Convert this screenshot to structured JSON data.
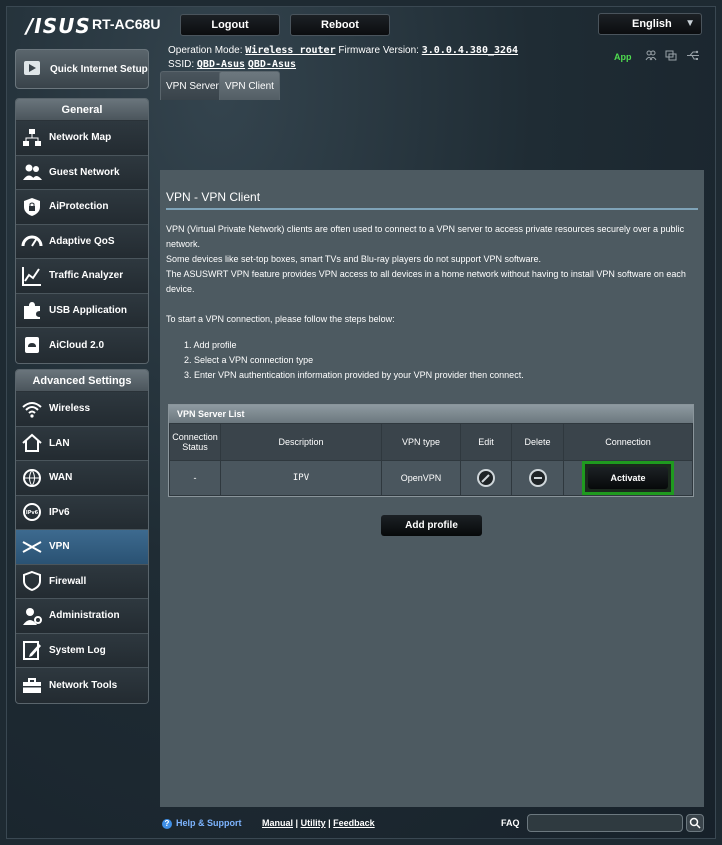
{
  "header": {
    "brand": "/ISUS",
    "model": "RT-AC68U",
    "logout_label": "Logout",
    "reboot_label": "Reboot",
    "language": "English",
    "operation_mode_label": "Operation Mode:",
    "operation_mode_value": "Wireless router",
    "firmware_label": "Firmware Version:",
    "firmware_value": "3.0.0.4.380_3264",
    "ssid_label": "SSID:",
    "ssid_1": "QBD-Asus",
    "ssid_2": "QBD-Asus",
    "app_label": "App"
  },
  "sidebar": {
    "quick_setup": "Quick Internet Setup",
    "general_title": "General",
    "general_items": [
      {
        "label": "Network Map",
        "icon": "network-map-icon"
      },
      {
        "label": "Guest Network",
        "icon": "guest-network-icon"
      },
      {
        "label": "AiProtection",
        "icon": "shield-lock-icon"
      },
      {
        "label": "Adaptive QoS",
        "icon": "speedometer-icon"
      },
      {
        "label": "Traffic Analyzer",
        "icon": "chart-icon"
      },
      {
        "label": "USB Application",
        "icon": "puzzle-icon"
      },
      {
        "label": "AiCloud 2.0",
        "icon": "cloud-icon"
      }
    ],
    "advanced_title": "Advanced Settings",
    "advanced_items": [
      {
        "label": "Wireless",
        "icon": "wifi-icon"
      },
      {
        "label": "LAN",
        "icon": "home-icon"
      },
      {
        "label": "WAN",
        "icon": "globe-icon"
      },
      {
        "label": "IPv6",
        "icon": "ipv6-icon"
      },
      {
        "label": "VPN",
        "icon": "vpn-icon"
      },
      {
        "label": "Firewall",
        "icon": "firewall-icon"
      },
      {
        "label": "Administration",
        "icon": "person-gear-icon"
      },
      {
        "label": "System Log",
        "icon": "notepad-icon"
      },
      {
        "label": "Network Tools",
        "icon": "toolbox-icon"
      }
    ],
    "active_item": "VPN"
  },
  "tabs": [
    {
      "label": "VPN Server",
      "active": false
    },
    {
      "label": "VPN Client",
      "active": true
    }
  ],
  "main": {
    "title": "VPN - VPN Client",
    "desc_1": "VPN (Virtual Private Network) clients are often used to connect to a VPN server to access private resources securely over a public network.",
    "desc_2": "Some devices like set-top boxes, smart TVs and Blu-ray players do not support VPN software.",
    "desc_3": "The ASUSWRT VPN feature provides VPN access to all devices in a home network without having to install VPN software on each device.",
    "steps_intro": "To start a VPN connection, please follow the steps below:",
    "steps": [
      "1. Add profile",
      "2. Select a VPN connection type",
      "3. Enter VPN authentication information provided by your VPN provider then connect."
    ],
    "table": {
      "title": "VPN Server List",
      "headers": [
        "Connection Status",
        "Description",
        "VPN type",
        "Edit",
        "Delete",
        "Connection"
      ],
      "rows": [
        {
          "status": "-",
          "description": "IPV",
          "vpn_type": "OpenVPN",
          "connection_label": "Activate"
        }
      ]
    },
    "add_profile_label": "Add profile"
  },
  "footer": {
    "help": "Help & Support",
    "manual": "Manual",
    "utility": "Utility",
    "feedback": "Feedback",
    "sep": "|",
    "faq": "FAQ"
  },
  "colors": {
    "accent_green": "#1f9a1f",
    "active_blue": "#2a5273",
    "panel": "#4d5a61"
  }
}
